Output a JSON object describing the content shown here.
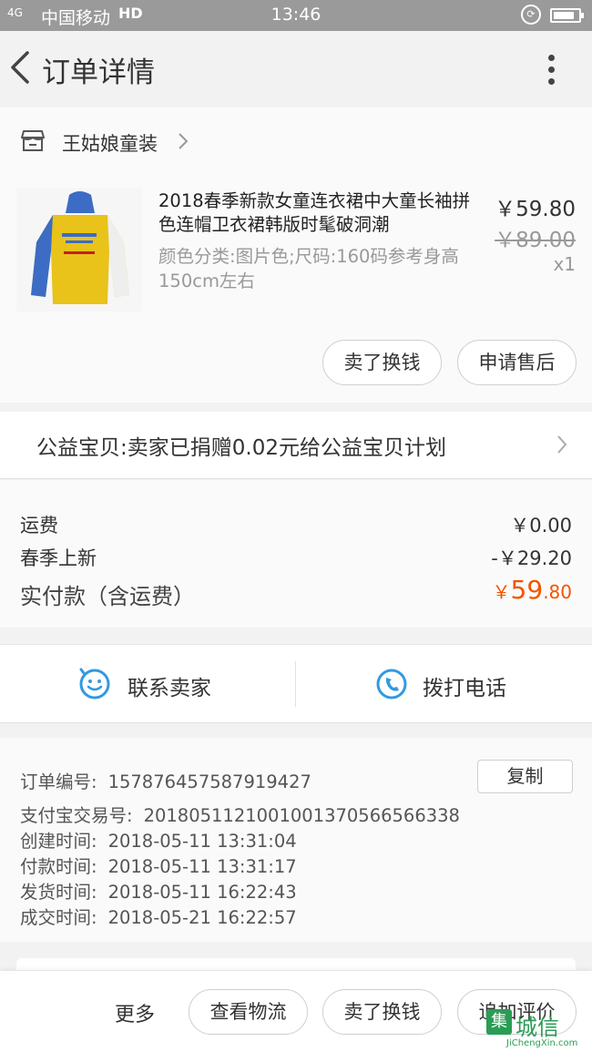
{
  "status_bar": {
    "signal": "4G",
    "carrier": "中国移动",
    "hd": "HD",
    "time": "13:46",
    "battery_level": 0.85
  },
  "header": {
    "title": "订单详情"
  },
  "shop": {
    "name": "王姑娘童装"
  },
  "product": {
    "title": "2018春季新款女童连衣裙中大童长袖拼色连帽卫衣裙韩版时髦破洞潮",
    "spec": "颜色分类:图片色;尺码:160码参考身高150cm左右",
    "price": "￥59.80",
    "original_price": "￥89.00",
    "quantity": "x1",
    "buttons": [
      "卖了换钱",
      "申请售后"
    ]
  },
  "charity": {
    "text": "公益宝贝:卖家已捐赠0.02元给公益宝贝计划"
  },
  "cost": {
    "shipping_label": "运费",
    "shipping_value": "￥0.00",
    "promo_label": "春季上新",
    "promo_value": "-￥29.20",
    "paid_label": "实付款（含运费）",
    "paid_currency": "￥",
    "paid_int": "59",
    "paid_dec": ".80",
    "accent_color": "#f25400"
  },
  "contact": {
    "seller_label": "联系卖家",
    "call_label": "拨打电话",
    "icon_color": "#3399e0"
  },
  "order_info": {
    "copy_label": "复制",
    "rows": [
      {
        "label": "订单编号:",
        "value": "157876457587919427"
      },
      {
        "label": "支付宝交易号:",
        "value": "2018051121001001370566566338"
      },
      {
        "label": "创建时间:",
        "value": "2018-05-11 13:31:04"
      },
      {
        "label": "付款时间:",
        "value": "2018-05-11 13:31:17"
      },
      {
        "label": "发货时间:",
        "value": "2018-05-11 16:22:43"
      },
      {
        "label": "成交时间:",
        "value": "2018-05-21 16:22:57"
      }
    ]
  },
  "bottom_bar": {
    "more": "更多",
    "buttons": [
      "查看物流",
      "卖了换钱",
      "追加评价"
    ]
  },
  "watermark": {
    "text": "城信",
    "url": "JiChengXin.com"
  }
}
